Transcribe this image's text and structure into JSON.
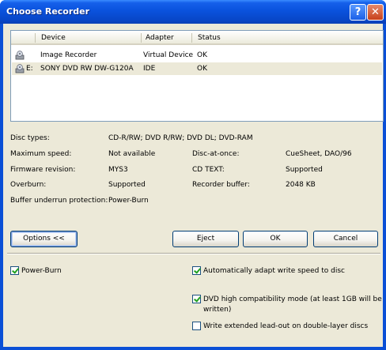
{
  "window": {
    "title": "Choose Recorder"
  },
  "list": {
    "columns": [
      "Device",
      "Adapter",
      "Status"
    ],
    "rows": [
      {
        "drive": "",
        "device": "Image Recorder",
        "adapter": "Virtual Device",
        "status": "OK",
        "icon": "image-recorder-icon"
      },
      {
        "drive": "E:",
        "device": "SONY DVD RW DW-G120A",
        "adapter": "IDE",
        "status": "OK",
        "icon": "dvd-drive-icon"
      }
    ]
  },
  "info": {
    "disc_types_label": "Disc types:",
    "disc_types_value": "CD-R/RW; DVD R/RW; DVD DL; DVD-RAM",
    "max_speed_label": "Maximum speed:",
    "max_speed_value": "Not available",
    "firmware_label": "Firmware revision:",
    "firmware_value": "MYS3",
    "overburn_label": "Overburn:",
    "overburn_value": "Supported",
    "buffer_label": "Buffer underrun protection:",
    "buffer_value": "Power-Burn",
    "dao_label": "Disc-at-once:",
    "dao_value": "CueSheet, DAO/96",
    "cdtext_label": "CD TEXT:",
    "cdtext_value": "Supported",
    "recbuf_label": "Recorder buffer:",
    "recbuf_value": "2048 KB"
  },
  "buttons": {
    "options": "Options <<",
    "eject": "Eject",
    "ok": "OK",
    "cancel": "Cancel"
  },
  "options": {
    "power_burn": {
      "label": "Power-Burn",
      "checked": true
    },
    "auto_adapt": {
      "label": "Automatically adapt write speed to disc",
      "checked": true
    },
    "dvd_compat_line1": "DVD high compatibility mode (at least 1GB will be",
    "dvd_compat_line2": "written)",
    "dvd_compat_checked": true,
    "extended_leadout": {
      "label": "Write extended lead-out on double-layer discs",
      "checked": false
    }
  },
  "colors": {
    "titlebar": "#0a52dd",
    "client_bg": "#ece9d8",
    "button_border": "#003c74",
    "check_mark": "#21a121"
  }
}
